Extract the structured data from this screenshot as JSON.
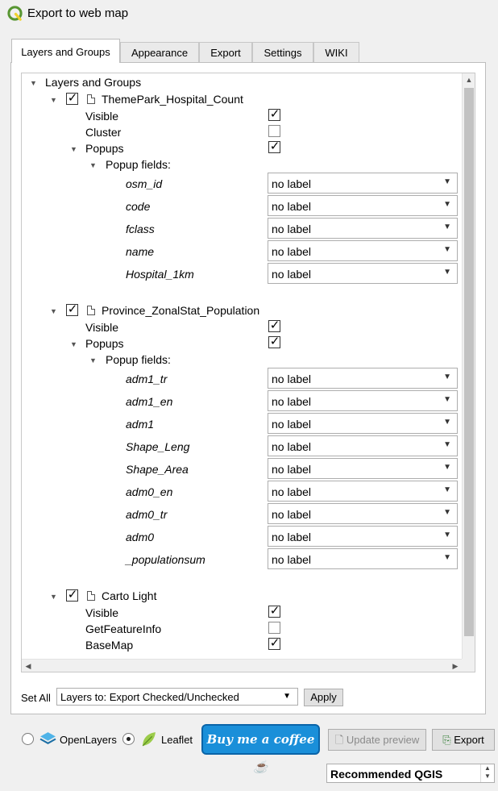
{
  "window": {
    "title": "Export to web map"
  },
  "tabs": [
    {
      "label": "Layers and Groups"
    },
    {
      "label": "Appearance"
    },
    {
      "label": "Export"
    },
    {
      "label": "Settings"
    },
    {
      "label": "WIKI"
    }
  ],
  "tree": {
    "root_label": "Layers and Groups",
    "layers": [
      {
        "name": "ThemePark_Hospital_Count",
        "checked": true,
        "props": [
          {
            "label": "Visible",
            "checked": true
          },
          {
            "label": "Cluster",
            "checked": false
          },
          {
            "label": "Popups",
            "checked": true
          }
        ],
        "popup_fields_label": "Popup fields:",
        "fields": [
          {
            "name": "osm_id",
            "value": "no label"
          },
          {
            "name": "code",
            "value": "no label"
          },
          {
            "name": "fclass",
            "value": "no label"
          },
          {
            "name": "name",
            "value": "no label"
          },
          {
            "name": "Hospital_1km",
            "value": "no label"
          }
        ]
      },
      {
        "name": "Province_ZonalStat_Population",
        "checked": true,
        "props": [
          {
            "label": "Visible",
            "checked": true
          },
          {
            "label": "Popups",
            "checked": true
          }
        ],
        "popup_fields_label": "Popup fields:",
        "fields": [
          {
            "name": "adm1_tr",
            "value": "no label"
          },
          {
            "name": "adm1_en",
            "value": "no label"
          },
          {
            "name": "adm1",
            "value": "no label"
          },
          {
            "name": "Shape_Leng",
            "value": "no label"
          },
          {
            "name": "Shape_Area",
            "value": "no label"
          },
          {
            "name": "adm0_en",
            "value": "no label"
          },
          {
            "name": "adm0_tr",
            "value": "no label"
          },
          {
            "name": "adm0",
            "value": "no label"
          },
          {
            "name": "_populationsum",
            "value": "no label"
          }
        ]
      },
      {
        "name": "Carto Light",
        "checked": true,
        "props": [
          {
            "label": "Visible",
            "checked": true
          },
          {
            "label": "GetFeatureInfo",
            "checked": false
          },
          {
            "label": "BaseMap",
            "checked": true
          }
        ]
      }
    ]
  },
  "set_all": {
    "label": "Set All",
    "combo_value": "Layers to: Export Checked/Unchecked",
    "apply_label": "Apply"
  },
  "footer": {
    "openlayers_label": "OpenLayers",
    "openlayers_selected": false,
    "leaflet_label": "Leaflet",
    "leaflet_selected": true,
    "coffee_label": "Buy me a coffee",
    "update_preview_label": "Update preview",
    "export_label": "Export",
    "recommended_value": "Recommended QGIS"
  },
  "colors": {
    "qgis_green": "#589632",
    "qgis_yellow": "#f0d22e",
    "coffee_blue": "#1a8fd9"
  }
}
